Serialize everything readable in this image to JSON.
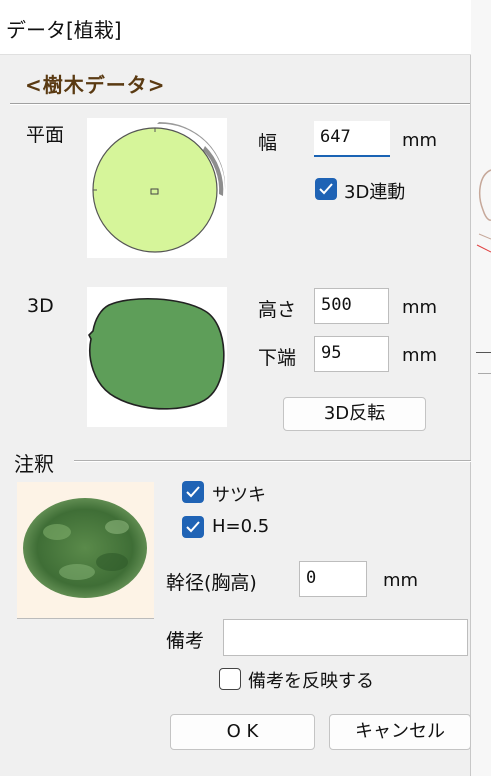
{
  "window": {
    "title": "データ[植栽]"
  },
  "header": {
    "title": "<樹木データ>"
  },
  "plan": {
    "label": "平面",
    "width_label": "幅",
    "width_value": "647",
    "width_unit": "mm",
    "link3d_checked": true,
    "link3d_label": "3D連動"
  },
  "view3d": {
    "label": "3D",
    "height_label": "高さ",
    "height_value": "500",
    "height_unit": "mm",
    "bottom_label": "下端",
    "bottom_value": "95",
    "bottom_unit": "mm",
    "flip_button": "3D反転"
  },
  "annotation": {
    "label": "注釈",
    "name_checked": true,
    "name_label": "サツキ",
    "height_checked": true,
    "height_label": "H=0.5",
    "trunk_label": "幹径(胸高)",
    "trunk_value": "0",
    "trunk_unit": "mm",
    "note_label": "備考",
    "note_value": "",
    "reflect_checked": false,
    "reflect_label": "備考を反映する"
  },
  "buttons": {
    "ok": "O K",
    "cancel": "キャンセル"
  },
  "colors": {
    "plan_fill": "#d6f59a",
    "view3d_fill": "#5e9e59",
    "checkbox_accent": "#1f63b5",
    "header_text": "#5a3a12"
  }
}
